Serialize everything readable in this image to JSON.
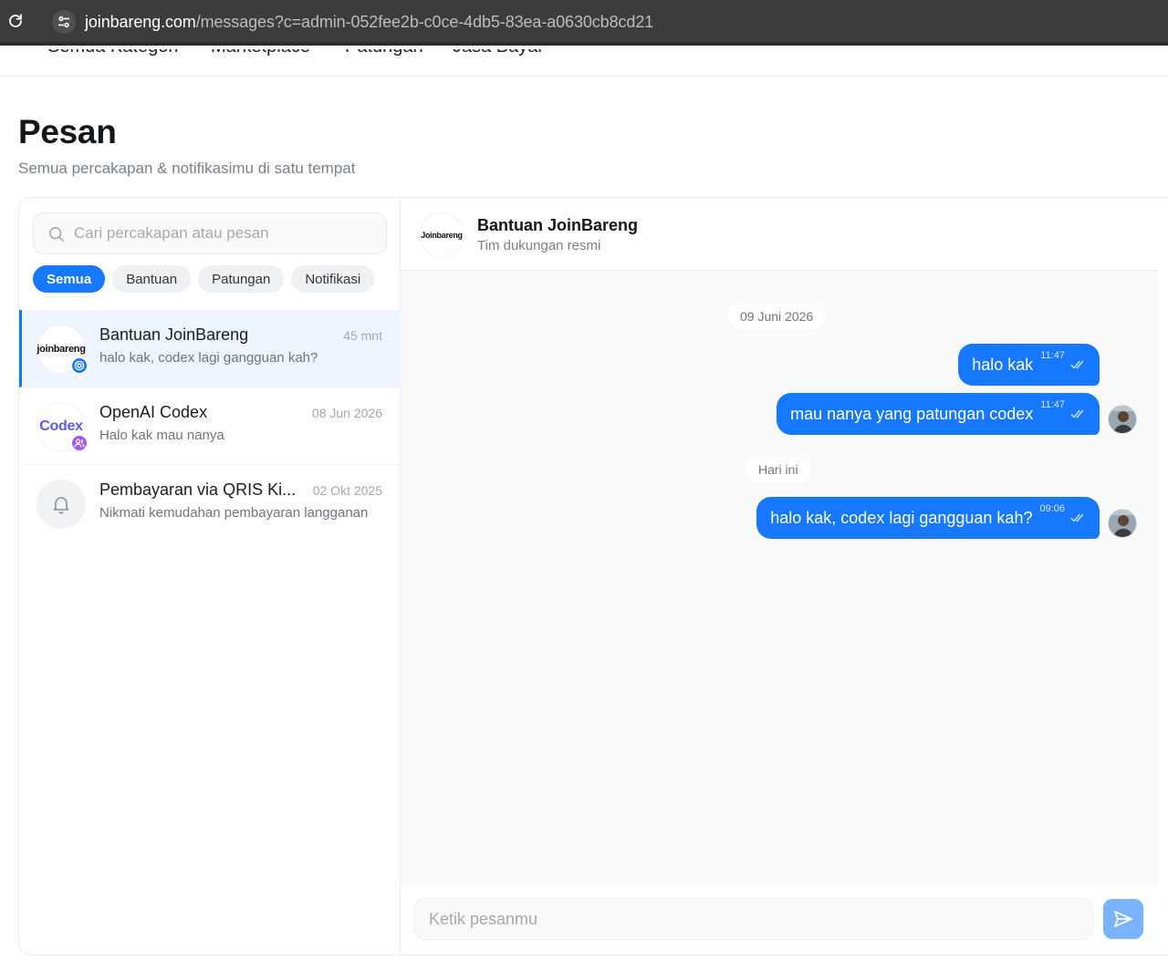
{
  "browser": {
    "url_host": "joinbareng.com",
    "url_path": "/messages?c=admin-052fee2b-c0ce-4db5-83ea-a0630cb8cd21"
  },
  "site_nav": {
    "items": [
      "Semua Kategori",
      "Marketplace",
      "Patungan",
      "Jasa Bayar"
    ]
  },
  "page": {
    "title": "Pesan",
    "subtitle": "Semua percakapan & notifikasimu di satu tempat"
  },
  "search": {
    "placeholder": "Cari percakapan atau pesan"
  },
  "filters": [
    "Semua",
    "Bantuan",
    "Patungan",
    "Notifikasi"
  ],
  "conversations": [
    {
      "name": "Bantuan JoinBareng",
      "time": "45 mnt",
      "preview": "halo kak, codex lagi gangguan kah?",
      "avatar_text": "joinbareng"
    },
    {
      "name": "OpenAI Codex",
      "time": "08 Jun 2026",
      "preview": "Halo kak mau nanya",
      "avatar_text": "Codex"
    },
    {
      "name": "Pembayaran via QRIS Ki...",
      "time": "02 Okt 2025",
      "preview": "Nikmati kemudahan pembayaran langganan"
    }
  ],
  "chat": {
    "header_name": "Bantuan JoinBareng",
    "header_sub": "Tim dukungan resmi",
    "header_avatar_text": "Joinbareng",
    "dates": [
      "09 Juni 2026",
      "Hari ini"
    ],
    "messages": [
      {
        "text": "halo kak",
        "time": "11:47"
      },
      {
        "text": "mau nanya yang patungan codex",
        "time": "11:47"
      },
      {
        "text": "halo kak, codex lagi gangguan kah?",
        "time": "09:06"
      }
    ],
    "composer_placeholder": "Ketik pesanmu"
  },
  "colors": {
    "accent": "#1677ff",
    "send_button": "#79b3fb"
  },
  "icons": {
    "reload": "reload-icon",
    "site_info": "tune-icon",
    "search": "search-icon",
    "bell": "bell-icon",
    "read_receipt": "double-check-icon",
    "send": "send-icon"
  }
}
